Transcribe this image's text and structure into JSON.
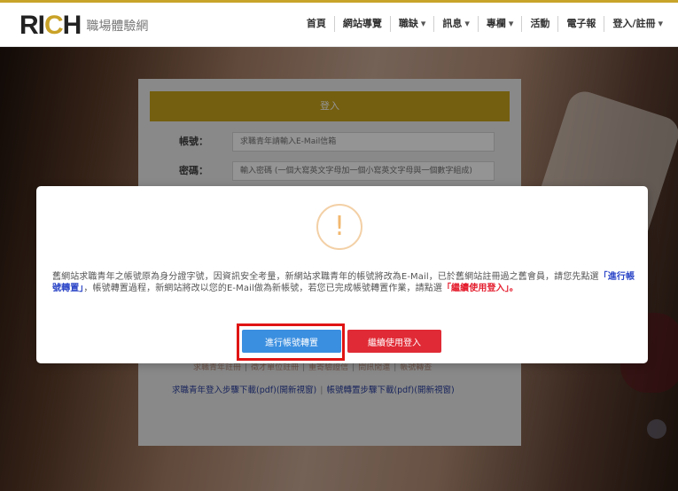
{
  "logo": {
    "brand_part1": "RI",
    "brand_c": "C",
    "brand_part2": "H",
    "subtitle": "職場體驗網"
  },
  "nav": {
    "items": [
      {
        "label": "首頁",
        "dropdown": false
      },
      {
        "label": "網站導覽",
        "dropdown": false
      },
      {
        "label": "職缺",
        "dropdown": true
      },
      {
        "label": "訊息",
        "dropdown": true
      },
      {
        "label": "專欄",
        "dropdown": true
      },
      {
        "label": "活動",
        "dropdown": false
      },
      {
        "label": "電子報",
        "dropdown": false
      },
      {
        "label": "登入/註冊",
        "dropdown": true
      }
    ],
    "caret": "▾"
  },
  "login": {
    "bar_label": "登入",
    "account_label": "帳號：",
    "account_placeholder": "求職青年請輸入E-Mail信箱",
    "password_label": "密碼：",
    "password_placeholder": "輸入密碼 (一個大寫英文字母加一個小寫英文字母與一個數字組成)",
    "links_row1": [
      "求職青年註冊",
      "徵才單位註冊",
      "重寄驗證信",
      "問訊閒連",
      "帳號轉查"
    ],
    "links_row2": [
      "求職青年登入步驟下載(pdf)(開新視窗)",
      "帳號轉置步驟下載(pdf)(開新視窗)"
    ]
  },
  "modal": {
    "icon": "!",
    "message": {
      "part1": "舊網站求職青年之帳號原為身分證字號，因資訊安全考量，新網站求職青年的帳號將改為E-Mail，已於舊網站註冊過之舊會員，請您先點選",
      "hl1": "「進行帳號轉置」",
      "part2": "，帳號轉置過程，新網站將改以您的E-Mail做為新帳號，若您已完成帳號轉置作業，請點選",
      "hl2": "「繼續使用登入」",
      "part3": "。"
    },
    "btn_convert": "進行帳號轉置",
    "btn_continue": "繼續使用登入"
  },
  "colors": {
    "brand_gold": "#c9a41d",
    "primary_blue": "#3b8fe0",
    "danger_red": "#e02a35",
    "highlight_red": "#e01414"
  }
}
